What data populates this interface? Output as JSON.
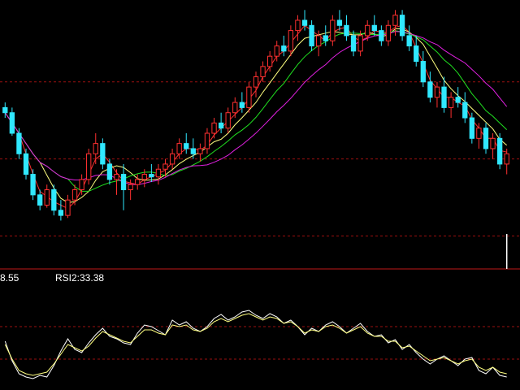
{
  "indicator_labels": {
    "value": "8.55",
    "rsi": "RSI2:33.38"
  },
  "colors": {
    "background": "#000000",
    "grid": "#9a1010",
    "separator": "#c01818",
    "candle_up": "#ff3030",
    "candle_down": "#30e8ff",
    "ma_short": "#ff3030",
    "ma_mid": "#ffff80",
    "ma_long": "#20e020",
    "ma_longest": "#e020e0",
    "rsi_primary": "#ffffff",
    "rsi_secondary": "#ffff80",
    "volume_bar": "#ffffff"
  },
  "chart_data": [
    {
      "type": "candlestick",
      "title": "",
      "ylim": [
        0,
        100
      ],
      "gridlines": [
        10,
        40,
        70
      ],
      "candles": [
        [
          60,
          62,
          56,
          58
        ],
        [
          58,
          60,
          49,
          50
        ],
        [
          50,
          52,
          40,
          42
        ],
        [
          42,
          44,
          32,
          34
        ],
        [
          34,
          36,
          24,
          26
        ],
        [
          26,
          28,
          20,
          22
        ],
        [
          22,
          30,
          21,
          28
        ],
        [
          28,
          30,
          18,
          20
        ],
        [
          20,
          24,
          16,
          18
        ],
        [
          18,
          26,
          17,
          24
        ],
        [
          24,
          30,
          22,
          28
        ],
        [
          28,
          34,
          26,
          32
        ],
        [
          32,
          44,
          30,
          42
        ],
        [
          42,
          50,
          38,
          46
        ],
        [
          46,
          48,
          36,
          38
        ],
        [
          38,
          40,
          30,
          32
        ],
        [
          32,
          36,
          26,
          34
        ],
        [
          34,
          38,
          20,
          28
        ],
        [
          28,
          32,
          24,
          30
        ],
        [
          30,
          34,
          28,
          32
        ],
        [
          32,
          36,
          29,
          34
        ],
        [
          34,
          38,
          31,
          33
        ],
        [
          33,
          38,
          30,
          36
        ],
        [
          36,
          40,
          33,
          38
        ],
        [
          38,
          44,
          36,
          42
        ],
        [
          42,
          48,
          40,
          46
        ],
        [
          46,
          50,
          42,
          44
        ],
        [
          44,
          48,
          40,
          42
        ],
        [
          42,
          46,
          39,
          44
        ],
        [
          44,
          52,
          42,
          50
        ],
        [
          50,
          56,
          48,
          54
        ],
        [
          54,
          58,
          50,
          52
        ],
        [
          52,
          60,
          50,
          58
        ],
        [
          58,
          64,
          56,
          62
        ],
        [
          62,
          66,
          58,
          60
        ],
        [
          60,
          70,
          58,
          68
        ],
        [
          68,
          74,
          64,
          72
        ],
        [
          72,
          78,
          70,
          76
        ],
        [
          76,
          82,
          74,
          80
        ],
        [
          80,
          86,
          78,
          84
        ],
        [
          84,
          88,
          80,
          82
        ],
        [
          82,
          92,
          80,
          90
        ],
        [
          90,
          96,
          86,
          94
        ],
        [
          94,
          98,
          90,
          92
        ],
        [
          92,
          94,
          82,
          84
        ],
        [
          84,
          90,
          80,
          88
        ],
        [
          88,
          92,
          84,
          86
        ],
        [
          86,
          96,
          84,
          94
        ],
        [
          94,
          98,
          90,
          92
        ],
        [
          92,
          96,
          86,
          88
        ],
        [
          88,
          90,
          80,
          82
        ],
        [
          82,
          90,
          80,
          88
        ],
        [
          88,
          94,
          86,
          92
        ],
        [
          92,
          96,
          88,
          90
        ],
        [
          90,
          92,
          84,
          86
        ],
        [
          86,
          94,
          84,
          92
        ],
        [
          92,
          98,
          88,
          96
        ],
        [
          96,
          98,
          86,
          88
        ],
        [
          88,
          92,
          82,
          84
        ],
        [
          84,
          88,
          76,
          78
        ],
        [
          78,
          82,
          68,
          70
        ],
        [
          70,
          74,
          62,
          64
        ],
        [
          64,
          70,
          60,
          68
        ],
        [
          68,
          72,
          58,
          60
        ],
        [
          60,
          66,
          56,
          64
        ],
        [
          64,
          68,
          60,
          62
        ],
        [
          62,
          66,
          54,
          56
        ],
        [
          56,
          58,
          46,
          48
        ],
        [
          48,
          54,
          44,
          52
        ],
        [
          52,
          54,
          42,
          44
        ],
        [
          44,
          50,
          40,
          48
        ],
        [
          48,
          50,
          36,
          38
        ],
        [
          38,
          44,
          34,
          42
        ]
      ],
      "volume_bar": {
        "index": 72,
        "value": 100
      }
    },
    {
      "type": "line",
      "title": "",
      "ylim": [
        0,
        100
      ],
      "gridlines": [
        30,
        70
      ],
      "series": [
        {
          "name": "",
          "values": [
            52,
            28,
            12,
            8,
            6,
            10,
            8,
            22,
            40,
            55,
            42,
            38,
            50,
            60,
            68,
            58,
            55,
            50,
            48,
            62,
            72,
            70,
            65,
            60,
            78,
            72,
            76,
            68,
            64,
            70,
            80,
            85,
            78,
            82,
            88,
            90,
            84,
            80,
            86,
            82,
            74,
            78,
            70,
            60,
            68,
            64,
            72,
            76,
            70,
            62,
            68,
            74,
            64,
            58,
            60,
            50,
            54,
            42,
            48,
            38,
            30,
            24,
            30,
            34,
            28,
            22,
            30,
            32,
            16,
            12,
            20,
            10,
            8
          ]
        },
        {
          "name": "",
          "values": [
            48,
            30,
            16,
            12,
            10,
            12,
            14,
            24,
            36,
            48,
            44,
            40,
            46,
            56,
            64,
            60,
            56,
            52,
            50,
            58,
            66,
            66,
            62,
            60,
            72,
            70,
            72,
            66,
            64,
            68,
            76,
            80,
            76,
            80,
            84,
            86,
            82,
            78,
            82,
            80,
            74,
            76,
            70,
            62,
            66,
            64,
            70,
            72,
            68,
            62,
            66,
            70,
            62,
            58,
            58,
            52,
            52,
            44,
            46,
            40,
            34,
            28,
            30,
            32,
            28,
            24,
            28,
            30,
            20,
            16,
            20,
            14,
            12
          ]
        }
      ]
    }
  ]
}
